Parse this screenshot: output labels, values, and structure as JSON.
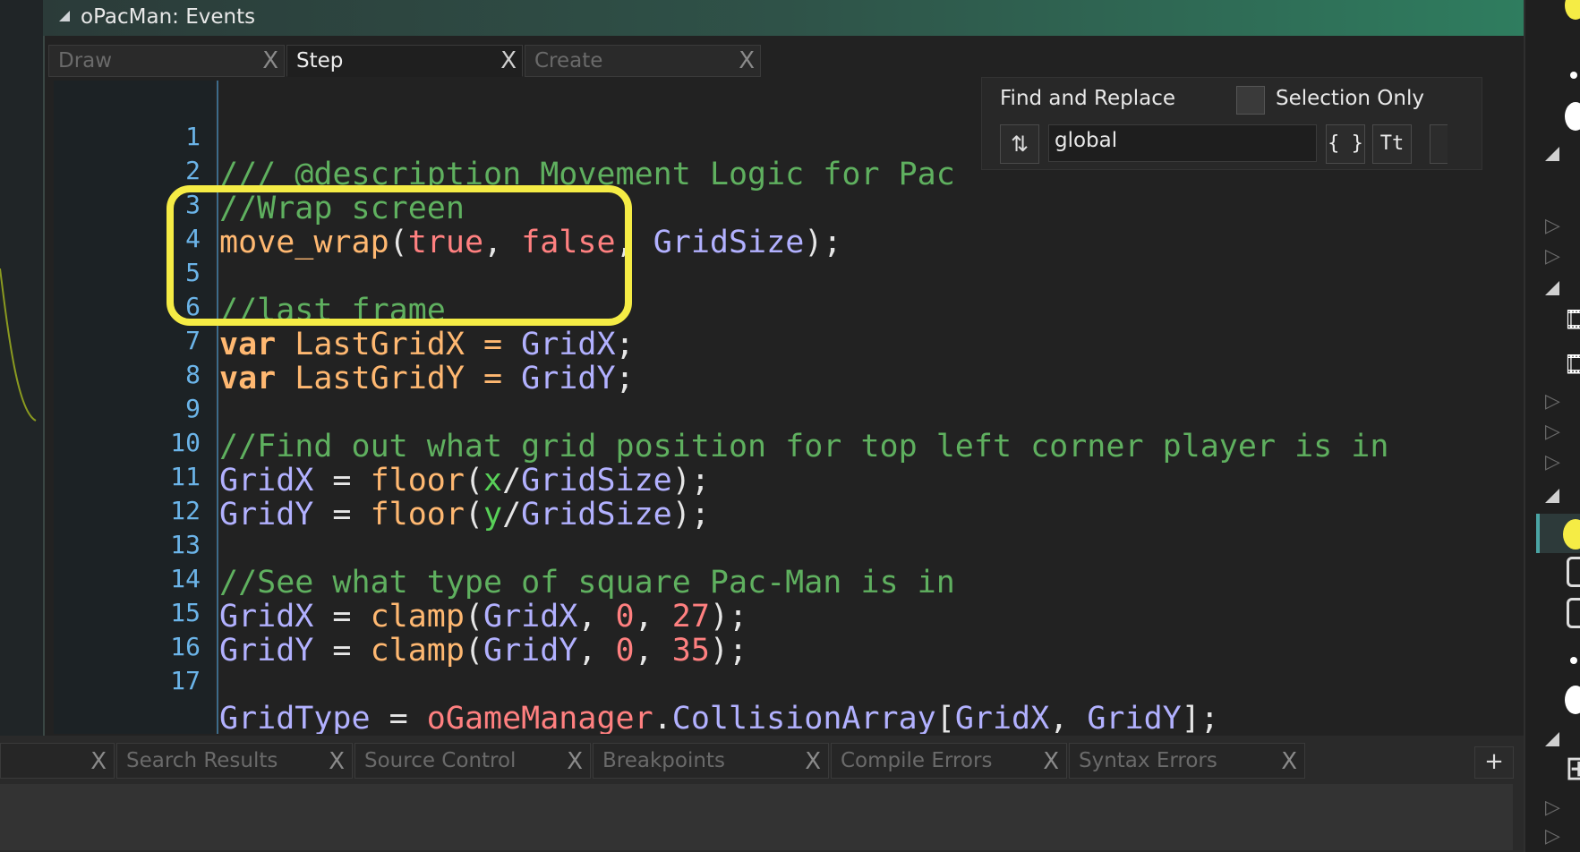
{
  "window": {
    "title": "oPacMan: Events"
  },
  "tabs": [
    {
      "label": "Draw",
      "close": "X"
    },
    {
      "label": "Step",
      "close": "X"
    },
    {
      "label": "Create",
      "close": "X"
    }
  ],
  "code": {
    "line_numbers": [
      "1",
      "2",
      "3",
      "4",
      "5",
      "6",
      "7",
      "8",
      "9",
      "10",
      "11",
      "12",
      "13",
      "14",
      "15",
      "16",
      "17"
    ],
    "l1": "/// @description Movement Logic for Pac",
    "l2": "//Wrap screen",
    "l3": {
      "fn": "move_wrap",
      "p1": "(",
      "a": "true",
      "s1": ", ",
      "b": "false",
      "s2": ", ",
      "c": "GridSize",
      "p2": ");"
    },
    "l5": "//last frame",
    "l6": {
      "kw": "var",
      "name": " LastGridX = ",
      "val": "GridX",
      "end": ";"
    },
    "l7": {
      "kw": "var",
      "name": " LastGridY = ",
      "val": "GridY",
      "end": ";"
    },
    "l9": "//Find out what grid position for top left corner player is in",
    "l10": {
      "a": "GridX",
      "eq": " = ",
      "fn": "floor",
      "p1": "(",
      "v": "x",
      "sl": "/",
      "g": "GridSize",
      "p2": ");"
    },
    "l11": {
      "a": "GridY",
      "eq": " = ",
      "fn": "floor",
      "p1": "(",
      "v": "y",
      "sl": "/",
      "g": "GridSize",
      "p2": ");"
    },
    "l13": "//See what type of square Pac-Man is in",
    "l14": {
      "a": "GridX",
      "eq": " = ",
      "fn": "clamp",
      "p1": "(",
      "g": "GridX",
      "s1": ", ",
      "n1": "0",
      "s2": ", ",
      "n2": "27",
      "p2": ");"
    },
    "l15": {
      "a": "GridY",
      "eq": " = ",
      "fn": "clamp",
      "p1": "(",
      "g": "GridY",
      "s1": ", ",
      "n1": "0",
      "s2": ", ",
      "n2": "35",
      "p2": ");"
    },
    "l17": {
      "a": "GridType",
      "eq": " = ",
      "obj": "oGameManager",
      "dot": ".",
      "arr": "CollisionArray",
      "b1": "[",
      "gx": "GridX",
      "cm": ", ",
      "gy": "GridY",
      "b2": "];"
    }
  },
  "find_replace": {
    "title": "Find and Replace",
    "selection_only_label": "Selection Only",
    "search_value": "global",
    "swap_icon": "swap-arrows-icon",
    "braces_label": "{ }",
    "case_label": "Tt"
  },
  "bottom_tabs": [
    {
      "label": "",
      "close": "X"
    },
    {
      "label": "Search Results",
      "close": "X"
    },
    {
      "label": "Source Control",
      "close": "X"
    },
    {
      "label": "Breakpoints",
      "close": "X"
    },
    {
      "label": "Compile Errors",
      "close": "X"
    },
    {
      "label": "Syntax Errors",
      "close": "X"
    }
  ],
  "add_tab_label": "+",
  "colors": {
    "comment": "#5fb05f",
    "function": "#ffb871",
    "constant": "#ff8080",
    "variable": "#b2b1ff",
    "highlight": "#f5ec45",
    "line_number": "#6bb4e8"
  }
}
